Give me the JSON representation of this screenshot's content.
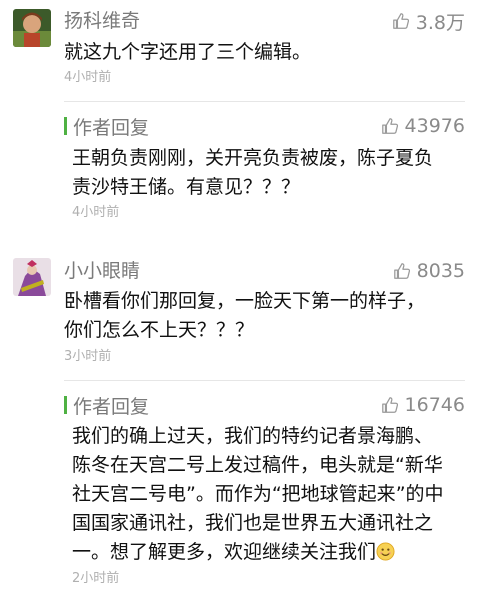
{
  "comments": [
    {
      "username": "扬科维奇",
      "likes": "3.8万",
      "lines": [
        "就这九个字还用了三个编辑。"
      ],
      "time": "4小时前"
    },
    {
      "reply_label": "作者回复",
      "likes": "43976",
      "lines": [
        "王朝负责刚刚，关开亮负责被废，陈子夏负",
        "责沙特王储。有意见？？？"
      ],
      "time": "4小时前"
    },
    {
      "username": "小小眼睛",
      "likes": "8035",
      "lines": [
        "卧槽看你们那回复，一脸天下第一的样子，",
        "你们怎么不上天？？？"
      ],
      "time": "3小时前"
    },
    {
      "reply_label": "作者回复",
      "likes": "16746",
      "lines": [
        "我们的确上过天，我们的特约记者景海鹏、",
        "陈冬在天宫二号上发过稿件，电头就是“新华",
        "社天宫二号电”。而作为“把地球管起来”的中",
        "国国家通讯社，我们也是世界五大通讯社之",
        "一。想了解更多，欢迎继续关注我们"
      ],
      "time": "2小时前"
    }
  ],
  "icons": {
    "like": "thumbs-up-icon",
    "smile": "smiling-face-emoji"
  },
  "colors": {
    "reply_bar": "#4fb143",
    "meta_text": "#7a7a7a",
    "time_text": "#b0b0b0",
    "body_text": "#111111"
  }
}
